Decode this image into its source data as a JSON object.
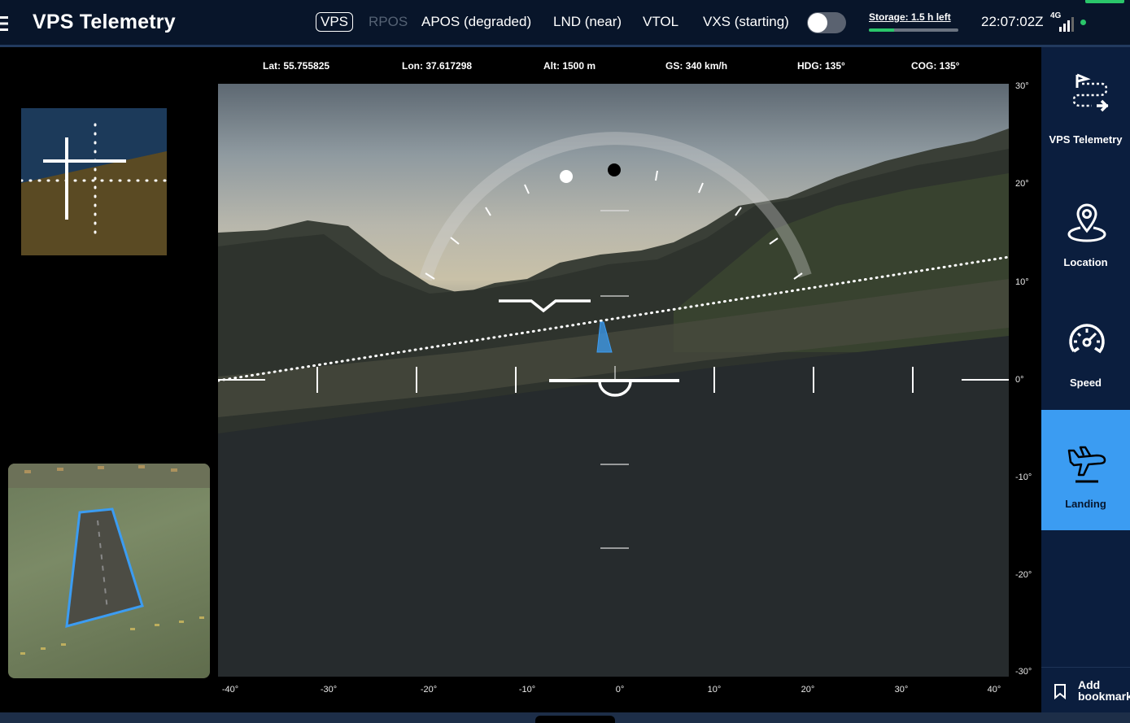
{
  "header": {
    "menu_icon": "menu-icon",
    "title": "VPS Telemetry",
    "modes": [
      {
        "label": "VPS",
        "state": "selected"
      },
      {
        "label": "RPOS",
        "state": "inactive"
      },
      {
        "label": "APOS (degraded)",
        "state": "active"
      },
      {
        "label": "LND (near)",
        "state": "active"
      },
      {
        "label": "VTOL",
        "state": "active"
      },
      {
        "label": "VXS (starting)",
        "state": "active"
      }
    ],
    "vxs_toggle": {
      "on": false
    },
    "storage": {
      "label": "Storage: 1.5 h left",
      "level": 0.28
    },
    "time": "22:07:02Z",
    "network": {
      "type": "4G",
      "icon": "signal-icon",
      "status_color": "#2ac66a"
    }
  },
  "telemetry": {
    "lat": "Lat: 55.755825",
    "lon": "Lon: 37.617298",
    "alt": "Alt: 1500 m",
    "gs": "GS: 340 km/h",
    "hdg": "HDG: 135°",
    "cog": "COG: 135°"
  },
  "hud": {
    "heading_ticks": [
      "-40°",
      "-30°",
      "-20°",
      "-10°",
      "0°",
      "10°",
      "20°",
      "30°",
      "40°"
    ],
    "pitch_ticks": [
      "30°",
      "20°",
      "10°",
      "0°",
      "-10°",
      "-20°",
      "-30°"
    ]
  },
  "sidebar": {
    "items": [
      {
        "label": "VPS Telemetry",
        "icon": "route-flag-plane-icon",
        "active": false
      },
      {
        "label": "Location",
        "icon": "location-pin-icon",
        "active": false
      },
      {
        "label": "Speed",
        "icon": "speedometer-icon",
        "active": false
      },
      {
        "label": "Landing",
        "icon": "landing-plane-icon",
        "active": true
      }
    ],
    "bookmark_label": "Add bookmark",
    "bookmark_icon": "bookmark-icon"
  },
  "colors": {
    "accent": "#3b9cf2",
    "topbar": "#08152a",
    "sidebar": "#0b1e3e",
    "ok": "#2ac66a"
  }
}
